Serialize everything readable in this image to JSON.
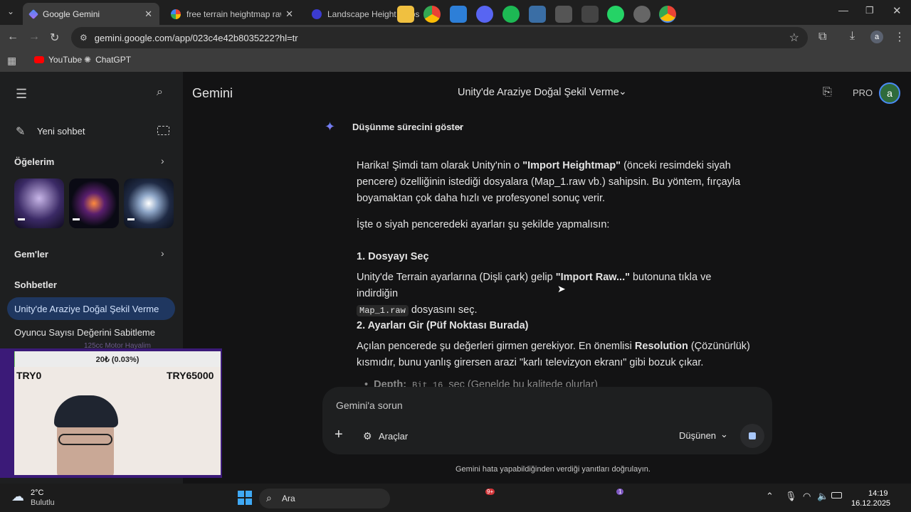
{
  "browser": {
    "tabs": [
      {
        "title": "Google Gemini",
        "active": true
      },
      {
        "title": "free terrain heightmap raw - Go",
        "active": false
      },
      {
        "title": "Landscape Height Maps - Moti",
        "active": false
      }
    ],
    "url": "gemini.google.com/app/023c4e42b8035222?hl=tr",
    "bookmarks": [
      "YouTube",
      "ChatGPT"
    ],
    "profile_initial": "a"
  },
  "sidebar": {
    "new_chat": "Yeni sohbet",
    "my_items": "Öğelerim",
    "gems": "Gem'ler",
    "chats_heading": "Sohbetler",
    "chats": [
      "Unity'de Araziye Doğal Şekil Verme",
      "Oyuncu Sayısı Değerini Sabitleme"
    ]
  },
  "header": {
    "app_name": "Gemini",
    "chat_title": "Unity'de Araziye Doğal Şekil Verme",
    "pro_badge": "PRO",
    "avatar_initial": "a"
  },
  "response": {
    "thinking_toggle": "Düşünme sürecini göster",
    "intro_prefix": "Harika! Şimdi tam olarak Unity'nin o ",
    "intro_bold": "\"Import Heightmap\"",
    "intro_suffix": " (önceki resimdeki siyah pencere) özelliğinin istediği dosyalara (Map_1.raw vb.) sahipsin. Bu yöntem, fırçayla boyamaktan çok daha hızlı ve profesyonel sonuç verir.",
    "instructions": "İşte o siyah penceredeki ayarları şu şekilde yapmalısın:",
    "step1_title": "1. Dosyayı Seç",
    "step1_prefix": "Unity'de Terrain ayarlarına (Dişli çark) gelip ",
    "step1_bold": "\"Import Raw...\"",
    "step1_mid": " butonuna tıkla ve indirdiğin",
    "step1_code": "Map_1.raw",
    "step1_suffix": " dosyasını seç.",
    "step2_title": "2. Ayarları Gir (Püf Noktası Burada)",
    "step2_prefix": "Açılan pencerede şu değerleri girmen gerekiyor. En önemlisi ",
    "step2_bold": "Resolution",
    "step2_suffix": " (Çözünürlük) kısmıdır, bunu yanlış girersen arazi \"karlı televizyon ekranı\" gibi bozuk çıkar.",
    "bullet_label": "Depth:",
    "bullet_code": "Bit 16",
    "bullet_text": " seç (Genelde bu kalitede olurlar)"
  },
  "composer": {
    "placeholder": "Gemini'a sorun",
    "tools": "Araçlar",
    "mode": "Düşünen"
  },
  "disclaimer": "Gemini hata yapabildiğinden verdiği yanıtları doğrulayın.",
  "overlay": {
    "donation_title": "125cc Motor Hayalim",
    "progress_text": "20₺ (0.03%)",
    "progress_fraction": 0.0003,
    "goal_min": "TRY0",
    "goal_max": "TRY65000"
  },
  "taskbar": {
    "temperature": "2°C",
    "weather": "Bulutlu",
    "search": "Ara",
    "time": "14:19",
    "date": "16.12.2025",
    "discord_badge": "9+",
    "whatsapp_badge": "1"
  },
  "colors": {
    "accent_blue": "#1f3760",
    "link_blue": "#4a8af4",
    "overlay_purple": "#3b1a78"
  }
}
